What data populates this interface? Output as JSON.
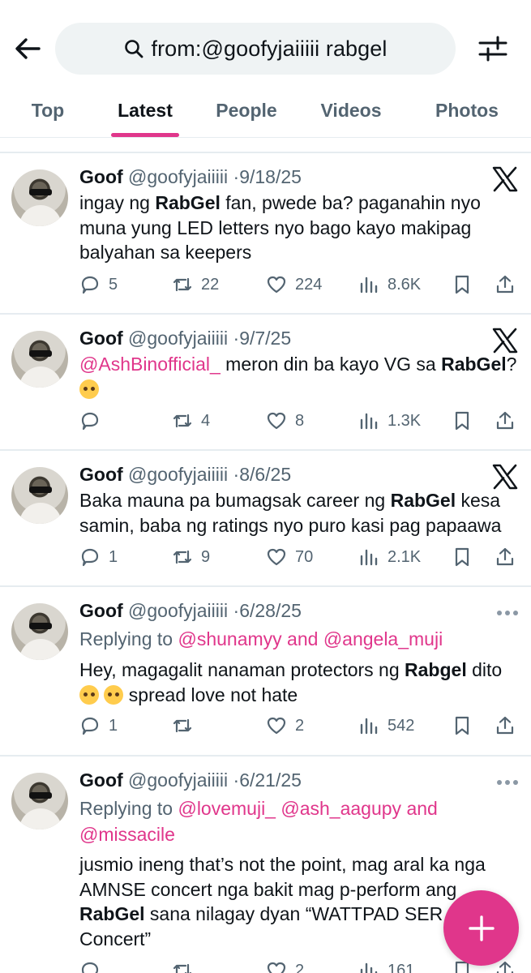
{
  "colors": {
    "accent": "#e0368b",
    "secondary_text": "#536471",
    "primary_text": "#0f1419"
  },
  "header": {
    "back_icon": "arrow-left-icon",
    "search_icon": "search-icon",
    "search_query": "from:@goofyjaiiiii rabgel",
    "filter_icon": "sliders-icon"
  },
  "tabs": [
    {
      "label": "Top",
      "active": false
    },
    {
      "label": "Latest",
      "active": true
    },
    {
      "label": "People",
      "active": false
    },
    {
      "label": "Videos",
      "active": false
    },
    {
      "label": "Photos",
      "active": false
    }
  ],
  "tweets": [
    {
      "name": "Goof",
      "handle": "@goofyjaiiiii",
      "separator": "·",
      "date": "9/18/25",
      "badge_icon": "x-logo-icon",
      "text": {
        "t1": "ingay ng ",
        "b1": "RabGel",
        "t2": " fan, pwede ba? paganahin nyo muna yung LED letters nyo bago kayo makipag balyahan sa keepers"
      },
      "replies": "5",
      "reposts": "22",
      "likes": "224",
      "views": "8.6K"
    },
    {
      "name": "Goof",
      "handle": "@goofyjaiiiii",
      "separator": "·",
      "date": "9/7/25",
      "badge_icon": "x-logo-icon",
      "text": {
        "mention": "@AshBinofficial_",
        "t1": " meron din ba kayo VG sa ",
        "b1": "RabGel",
        "t2": "?",
        "emoji": "smiling-face-emoji"
      },
      "replies": "",
      "reposts": "4",
      "likes": "8",
      "views": "1.3K"
    },
    {
      "name": "Goof",
      "handle": "@goofyjaiiiii",
      "separator": "·",
      "date": "8/6/25",
      "badge_icon": "x-logo-icon",
      "text": {
        "t1": "Baka mauna pa bumagsak career ng ",
        "b1": "RabGel",
        "t2": " kesa samin, baba ng ratings nyo puro kasi pag papaawa"
      },
      "replies": "1",
      "reposts": "9",
      "likes": "70",
      "views": "2.1K"
    },
    {
      "name": "Goof",
      "handle": "@goofyjaiiiii",
      "separator": "·",
      "date": "6/28/25",
      "badge_icon": "more-icon",
      "replying_label": "Replying to ",
      "reply_mention1": "@shunamyy",
      "reply_and": " and ",
      "reply_mention2": "@angela_muji",
      "text": {
        "t1": "Hey, magagalit nanaman protectors ng ",
        "b1": "Rabgel",
        "t2": " dito",
        "emoji": "pleading-face-emoji",
        "t3": " spread love not hate"
      },
      "replies": "1",
      "reposts": "",
      "likes": "2",
      "views": "542"
    },
    {
      "name": "Goof",
      "handle": "@goofyjaiiiii",
      "separator": "·",
      "date": "6/21/25",
      "badge_icon": "more-icon",
      "replying_label": "Replying to ",
      "reply_mention1": "@lovemuji_",
      "reply_mention2": "@ash_aagupy",
      "reply_and": " and ",
      "reply_mention3": "@missacile",
      "text": {
        "t1": "jusmio ineng that’s not the point, mag aral ka nga AMNSE concert nga bakit mag p-perform ang ",
        "b1": "RabGel",
        "t2": " sana nilagay dyan “WATTPAD SER",
        "t3": "Concert”"
      },
      "replies": "",
      "reposts": "",
      "likes": "2",
      "views": "161"
    }
  ],
  "fab": {
    "icon": "plus-icon"
  }
}
